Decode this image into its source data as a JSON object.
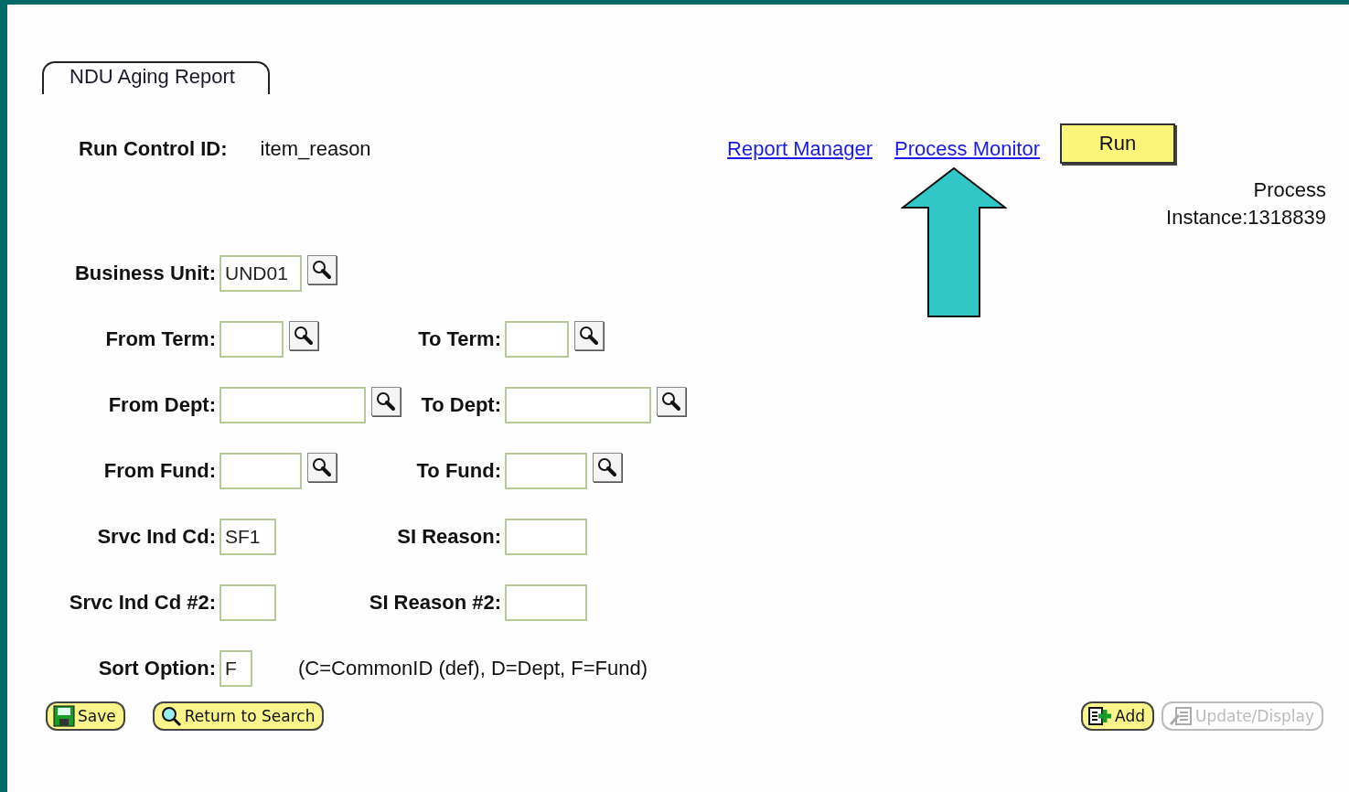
{
  "tab": {
    "label": "NDU Aging Report",
    "selected": true
  },
  "run_control": {
    "label": "Run Control ID:",
    "value": "item_reason"
  },
  "links": [
    "Report Manager",
    "Process Monitor"
  ],
  "run_button": "Run",
  "process_instance": "Process Instance:1318839",
  "rows": [
    {
      "left": {
        "label": "Business Unit:",
        "value": "UND01",
        "lookup": true
      }
    },
    {
      "left": {
        "label": "From Term:",
        "lookup": true
      },
      "right": {
        "label": "To Term:",
        "lookup": true
      }
    },
    {
      "left": {
        "label": "From Dept:",
        "lookup": true
      },
      "right": {
        "label": "To Dept:",
        "lookup": true
      }
    },
    {
      "left": {
        "label": "From Fund:",
        "lookup": true
      },
      "right": {
        "label": "To Fund:",
        "lookup": true
      }
    },
    {
      "left": {
        "label": "Srvc Ind Cd:",
        "value": "SF1",
        "lookup": false
      },
      "right": {
        "label": "SI Reason:",
        "lookup": false
      }
    },
    {
      "left": {
        "label": "Srvc Ind Cd #2:",
        "lookup": false
      },
      "right": {
        "label": "SI Reason #2:",
        "lookup": false
      }
    },
    {
      "left": {
        "label": "Sort Option:",
        "value": "F",
        "lookup": false
      },
      "hint": "(C=CommonID (def), D=Dept, F=Fund)"
    }
  ],
  "buttons_left": [
    {
      "kind": "save",
      "label": "Save",
      "disabled": false
    },
    {
      "kind": "search",
      "label": "Return to Search",
      "disabled": false
    }
  ],
  "buttons_right": [
    {
      "kind": "add",
      "label": "Add",
      "disabled": false
    },
    {
      "kind": "update",
      "label": "Update/Display",
      "disabled": true
    }
  ]
}
